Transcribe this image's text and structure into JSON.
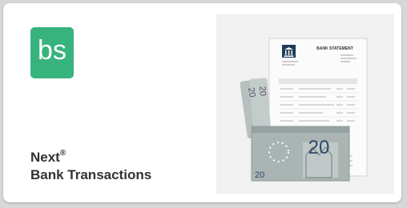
{
  "app": {
    "logo_text": "bs",
    "title_line1": "Next",
    "title_mark": "®",
    "title_line2": "Bank Transactions"
  },
  "illustration": {
    "statement_heading": "BANK STATEMENT",
    "banknote_value": "20",
    "colors": {
      "logo_bg": "#37b37e",
      "statement_header": "#1f3d59",
      "banknote": "#aab5b4"
    }
  }
}
